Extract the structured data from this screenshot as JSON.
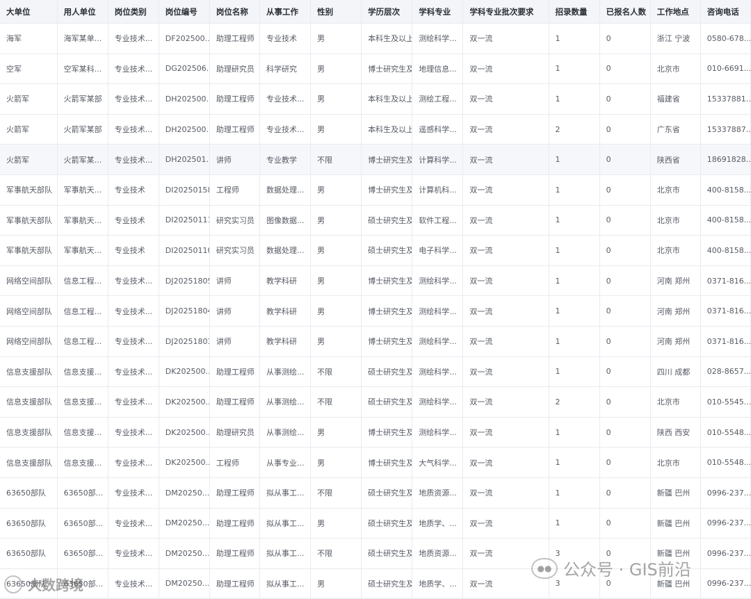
{
  "table": {
    "headers": [
      "大单位",
      "用人单位",
      "岗位类别",
      "岗位编号",
      "岗位名称",
      "从事工作",
      "性别",
      "学历层次",
      "学科专业",
      "学科专业批次要求",
      "招录数量",
      "已报名人数",
      "工作地点",
      "咨询电话"
    ],
    "rows": [
      [
        "海军",
        "海军某单...",
        "专业技术...",
        "DF202500...",
        "助理工程师",
        "专业技术",
        "男",
        "本科生及以上",
        "测绘科学...",
        "双一流",
        "1",
        "0",
        "浙江 宁波",
        "0580-678..."
      ],
      [
        "空军",
        "空军某科...",
        "专业技术...",
        "DG202506...",
        "助理研究员",
        "科学研究",
        "男",
        "博士研究生及",
        "地理信息...",
        "双一流",
        "1",
        "0",
        "北京市",
        "010-6691..."
      ],
      [
        "火箭军",
        "火箭军某部",
        "专业技术...",
        "DH202500...",
        "助理工程师",
        "专业技术...",
        "男",
        "本科生及以上",
        "测绘工程...",
        "双一流",
        "1",
        "0",
        "福建省",
        "15337881..."
      ],
      [
        "火箭军",
        "火箭军某部",
        "专业技术...",
        "DH202500...",
        "助理工程师",
        "专业技术...",
        "男",
        "本科生及以上",
        "遥感科学...",
        "双一流",
        "2",
        "0",
        "广东省",
        "15337887..."
      ],
      [
        "火箭军",
        "火箭军某...",
        "专业技术...",
        "DH202501...",
        "讲师",
        "专业教学",
        "不限",
        "博士研究生及",
        "计算科学...",
        "双一流",
        "1",
        "0",
        "陕西省",
        "18691828..."
      ],
      [
        "军事航天部队",
        "军事航天...",
        "专业技术",
        "DI20250158",
        "工程师",
        "数据处理...",
        "男",
        "博士研究生及",
        "计算机科...",
        "双一流",
        "1",
        "0",
        "北京市",
        "400-8158..."
      ],
      [
        "军事航天部队",
        "军事航天...",
        "专业技术",
        "DI20250111",
        "研究实习员",
        "图像数据...",
        "男",
        "硕士研究生及",
        "软件工程...",
        "双一流",
        "1",
        "0",
        "北京市",
        "400-8158..."
      ],
      [
        "军事航天部队",
        "军事航天...",
        "专业技术",
        "DI20250110",
        "研究实习员",
        "数据处理...",
        "男",
        "硕士研究生及",
        "电子科学...",
        "双一流",
        "1",
        "0",
        "北京市",
        "400-8158..."
      ],
      [
        "网络空间部队",
        "信息工程...",
        "专业技术...",
        "DJ20251805",
        "讲师",
        "教学科研",
        "男",
        "博士研究生及",
        "测绘科学...",
        "双一流",
        "1",
        "0",
        "河南 郑州",
        "0371-816..."
      ],
      [
        "网络空间部队",
        "信息工程...",
        "专业技术...",
        "DJ20251804",
        "讲师",
        "教学科研",
        "男",
        "博士研究生及",
        "测绘科学...",
        "双一流",
        "1",
        "0",
        "河南 郑州",
        "0371-816..."
      ],
      [
        "网络空间部队",
        "信息工程...",
        "专业技术...",
        "DJ20251803",
        "讲师",
        "教学科研",
        "男",
        "博士研究生及",
        "测绘科学...",
        "双一流",
        "1",
        "0",
        "河南 郑州",
        "0371-816..."
      ],
      [
        "信息支援部队",
        "信息支援...",
        "专业技术...",
        "DK202500...",
        "助理工程师",
        "从事测绘...",
        "不限",
        "硕士研究生及",
        "测绘科学...",
        "双一流",
        "1",
        "0",
        "四川 成都",
        "028-8657..."
      ],
      [
        "信息支援部队",
        "信息支援...",
        "专业技术...",
        "DK202500...",
        "助理工程师",
        "从事测绘...",
        "不限",
        "硕士研究生及",
        "测绘科学...",
        "双一流",
        "2",
        "0",
        "北京市",
        "010-5545..."
      ],
      [
        "信息支援部队",
        "信息支援...",
        "专业技术...",
        "DK202500...",
        "助理研究员",
        "从事测绘...",
        "男",
        "博士研究生及",
        "测绘科学...",
        "双一流",
        "1",
        "0",
        "陕西 西安",
        "010-5548..."
      ],
      [
        "信息支援部队",
        "信息支援...",
        "专业技术...",
        "DK202500...",
        "工程师",
        "从事专业...",
        "男",
        "博士研究生及",
        "大气科学...",
        "双一流",
        "1",
        "0",
        "北京市",
        "010-5548..."
      ],
      [
        "63650部队",
        "63650部...",
        "专业技术...",
        "DM20250...",
        "助理工程师",
        "拟从事工...",
        "不限",
        "硕士研究生及",
        "地质资源...",
        "双一流",
        "1",
        "0",
        "新疆 巴州",
        "0996-237..."
      ],
      [
        "63650部队",
        "63650部...",
        "专业技术...",
        "DM20250...",
        "助理工程师",
        "拟从事工...",
        "男",
        "硕士研究生及",
        "地质学、...",
        "双一流",
        "1",
        "0",
        "新疆 巴州",
        "0996-237..."
      ],
      [
        "63650部队",
        "63650部...",
        "专业技术...",
        "DM20250...",
        "助理工程师",
        "拟从事工...",
        "不限",
        "硕士研究生及",
        "地质资源...",
        "双一流",
        "3",
        "0",
        "新疆 巴州",
        "0996-237..."
      ],
      [
        "63650部队",
        "63650部...",
        "专业技术...",
        "DM20250...",
        "助理工程师",
        "拟从事工...",
        "男",
        "硕士研究生及",
        "地质学、...",
        "双一流",
        "3",
        "0",
        "新疆 巴州",
        "0996-237..."
      ]
    ],
    "highlighted_row": 4
  },
  "watermark": {
    "wechat_text": "公众号 · GIS前沿",
    "logo_text": "大数跨境"
  }
}
